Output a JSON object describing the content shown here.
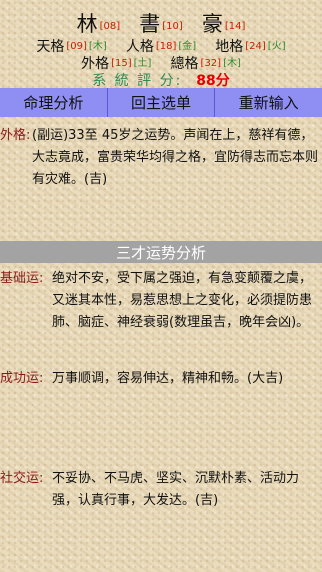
{
  "name": {
    "chars": [
      {
        "char": "林",
        "stroke": "[08]"
      },
      {
        "char": "書",
        "stroke": "[10]"
      },
      {
        "char": "豪",
        "stroke": "[14]"
      }
    ]
  },
  "grids": {
    "row1": [
      {
        "label": "天格",
        "value": "[09]",
        "element": "[木]"
      },
      {
        "label": "人格",
        "value": "[18]",
        "element": "[金]"
      },
      {
        "label": "地格",
        "value": "[24]",
        "element": "[火]"
      }
    ],
    "row2": [
      {
        "label": "外格",
        "value": "[15]",
        "element": "[土]"
      },
      {
        "label": "總格",
        "value": "[32]",
        "element": "[木]"
      }
    ]
  },
  "score": {
    "label": "系 統 評 分:",
    "value": "88分"
  },
  "menu": {
    "items": [
      {
        "label": "命理分析"
      },
      {
        "label": "回主选单"
      },
      {
        "label": "重新输入"
      }
    ]
  },
  "outer_grid": {
    "label": "外格:",
    "text": "(副运)33至 45岁之运势。声闻在上，慈祥有德，大志竟成，富贵荣华均得之格，宜防得志而忘本则有灾难。(吉)"
  },
  "section_title": "三才运势分析",
  "analysis": [
    {
      "label": "基础运:",
      "text": "绝对不安，受下属之强迫，有急变颠覆之虞，又迷其本性，易惹思想上之变化，必须提防患肺、脑症、神经衰弱(数理虽吉，晚年会凶)。"
    },
    {
      "label": "成功运:",
      "text": "万事顺调，容易伸达，精神和畅。(大吉)"
    },
    {
      "label": "社交运:",
      "text": "不妥协、不马虎、坚实、沉默朴素、活动力强，认真行事，大发达。(吉)"
    }
  ]
}
